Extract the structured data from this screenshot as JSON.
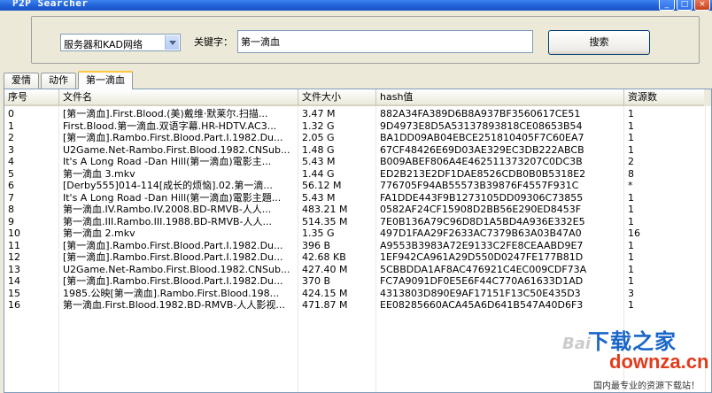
{
  "window": {
    "title": "P2P Searcher",
    "buttons": {
      "minimize": "_",
      "maximize": "□",
      "close": "×"
    }
  },
  "search": {
    "source_selected": "服务器和KAD网络",
    "keyword_label": "关键字：",
    "keyword_value": "第一滴血",
    "search_button": "搜索"
  },
  "tabs": [
    {
      "label": "爱情",
      "active": false
    },
    {
      "label": "动作",
      "active": false
    },
    {
      "label": "第一滴血",
      "active": true
    }
  ],
  "table": {
    "headers": [
      "序号",
      "文件名",
      "文件大小",
      "hash值",
      "资源数"
    ],
    "rows": [
      [
        "0",
        "[第一滴血].First.Blood.(美)戴维·默莱尔.扫描...",
        "3.47 M",
        "882A34FA389D6B8A937BF3560617CE51",
        "1"
      ],
      [
        "1",
        "First.Blood.第一滴血.双语字幕.HR-HDTV.AC3...",
        "1.32 G",
        "9D4973E8D5A53137893818CE08653B54",
        "1"
      ],
      [
        "2",
        "[第一滴血].Rambo.First.Blood.Part.I.1982.Du...",
        "2.05 G",
        "BA1DD09AB04EBCE251810405F7C60EA7",
        "1"
      ],
      [
        "3",
        "U2Game.Net-Rambo.First.Blood.1982.CNSub...",
        "1.48 G",
        "67CF48426E69D03AE329EC3DB222ABCB",
        "1"
      ],
      [
        "4",
        " It's A Long Road -Dan Hill(第一滴血)電影主...",
        "5.43 M",
        "B009ABEF806A4E462511373207C0DC3B",
        "2"
      ],
      [
        "5",
        "第一滴血  3.mkv",
        "1.44 G",
        "ED2B213E2DF1DAE8526CDB0B0B5318E2",
        "8"
      ],
      [
        "6",
        "[Derby555]014-114[成长的烦恼].02.第一滴...",
        "56.12 M",
        "776705F94AB55573B39876F4557F931C",
        "*"
      ],
      [
        "7",
        "It's A Long Road -Dan Hill(第一滴血)電影主題...",
        "5.43 M",
        "FA1DDE443F9B1273105DD09306C73855",
        "1"
      ],
      [
        "8",
        "第一滴血.IV.Rambo.IV.2008.BD-RMVB-人人...",
        "483.21 M",
        "0582AF24CF15908D2BB56E290ED8453F",
        "1"
      ],
      [
        "9",
        "第一滴血.III.Rambo.III.1988.BD-RMVB-人人...",
        "514.35 M",
        "7E0B136A79C96D8D1A5BD4A936E332E5",
        "1"
      ],
      [
        "10",
        "第一滴血  2.mkv",
        "1.35 G",
        "497D1FAA29F2633AC7379B63A03B47A0",
        "16"
      ],
      [
        "11",
        "[第一滴血].Rambo.First.Blood.Part.I.1982.Du...",
        "396 B",
        "A9553B3983A72E9133C2FE8CEAABD9E7",
        "1"
      ],
      [
        "12",
        "[第一滴血].Rambo.First.Blood.Part.I.1982.Du...",
        "42.68 KB",
        "1EF942CA961A29D550D0247FE177B81D",
        "1"
      ],
      [
        "13",
        "U2Game.Net-Rambo.First.Blood.1982.CNSub...",
        "427.40 M",
        "5CBBDDA1AF8AC476921C4EC009CDF73A",
        "1"
      ],
      [
        "14",
        "[第一滴血].Rambo.First.Blood.Part.I.1982.Du...",
        "370 B",
        "FC7A9091DF0E5E6F44C770A61633D1AD",
        "1"
      ],
      [
        "15",
        "1985.公映[第一滴血].Rambo.First.Blood.198...",
        "424.15 M",
        "4313803D890E9AF17151F13C50E435D3",
        "3"
      ],
      [
        "16",
        "第一滴血.First.Blood.1982.BD-RMVB-人人影视...",
        "471.87 M",
        "EE08285660ACA45A6D641B547A40D6F3",
        "1"
      ]
    ]
  },
  "watermark": {
    "baidu": "Bai",
    "logo_cn": "下载之家",
    "logo_en": "downza.cn",
    "tagline": "国内最专业的资源下载站！"
  },
  "colors": {
    "titlebar": "#1f5fd6",
    "window_bg": "#ece9d8",
    "active_tab_accent": "#ffc83c",
    "logo_blue": "#1a66c8",
    "logo_red": "#e23b1c"
  }
}
